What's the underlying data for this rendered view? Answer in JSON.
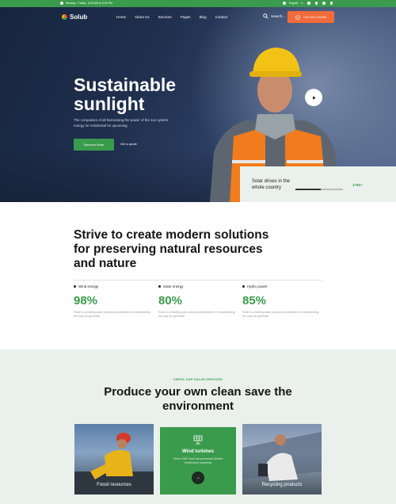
{
  "topbar": {
    "hours": "Monday - Friday : 8:00 AM to 6:00 PM",
    "language": "English"
  },
  "nav": {
    "logo": "Solub",
    "items": [
      "Home",
      "About Us",
      "Services",
      "Pages",
      "Blog",
      "Contact"
    ],
    "search": "Search...",
    "cta": "+123 2222 444455"
  },
  "hero": {
    "title": "Sustainable sunlight",
    "subtitle": "The companies of all harnessing the power of the sun system energy for residential for upcoming",
    "primary_button": "Discover More",
    "secondary_link": "Get a quote"
  },
  "solar_card": {
    "text": "Solar drives in the whole country",
    "percent": "175k+",
    "progress": 0.53
  },
  "strive": {
    "heading": "Strive to create modern solutions for preserving natural resources and nature"
  },
  "stats": [
    {
      "label": "Wind energy",
      "value": "98%",
      "desc": "Solar is a leading solar company dedicated to revolutionizing the way we generate"
    },
    {
      "label": "Solar energy",
      "value": "80%",
      "desc": "Solar is a leading solar company dedicated to revolutionizing the way we generate"
    },
    {
      "label": "Hydro power",
      "value": "85%",
      "desc": "Solar is a leading solar company dedicated to revolutionizing the way we generate"
    }
  ],
  "services": {
    "kicker": "CHECK OUR SOLAR SERVICES",
    "title": "Produce your own clean save the environment",
    "cards": [
      {
        "title": "Fossil resources"
      },
      {
        "title": "Wind turbines",
        "desc": "Since 1990 Toad has pioneered distinct enrichment, powering"
      },
      {
        "title": "Recycling products"
      }
    ],
    "arrow": "→"
  },
  "colors": {
    "brand_green": "#3a9b4c",
    "accent_orange": "#f26b3a",
    "hero_navy": "#1f2f4d",
    "section_tint": "#eaf1ec"
  }
}
